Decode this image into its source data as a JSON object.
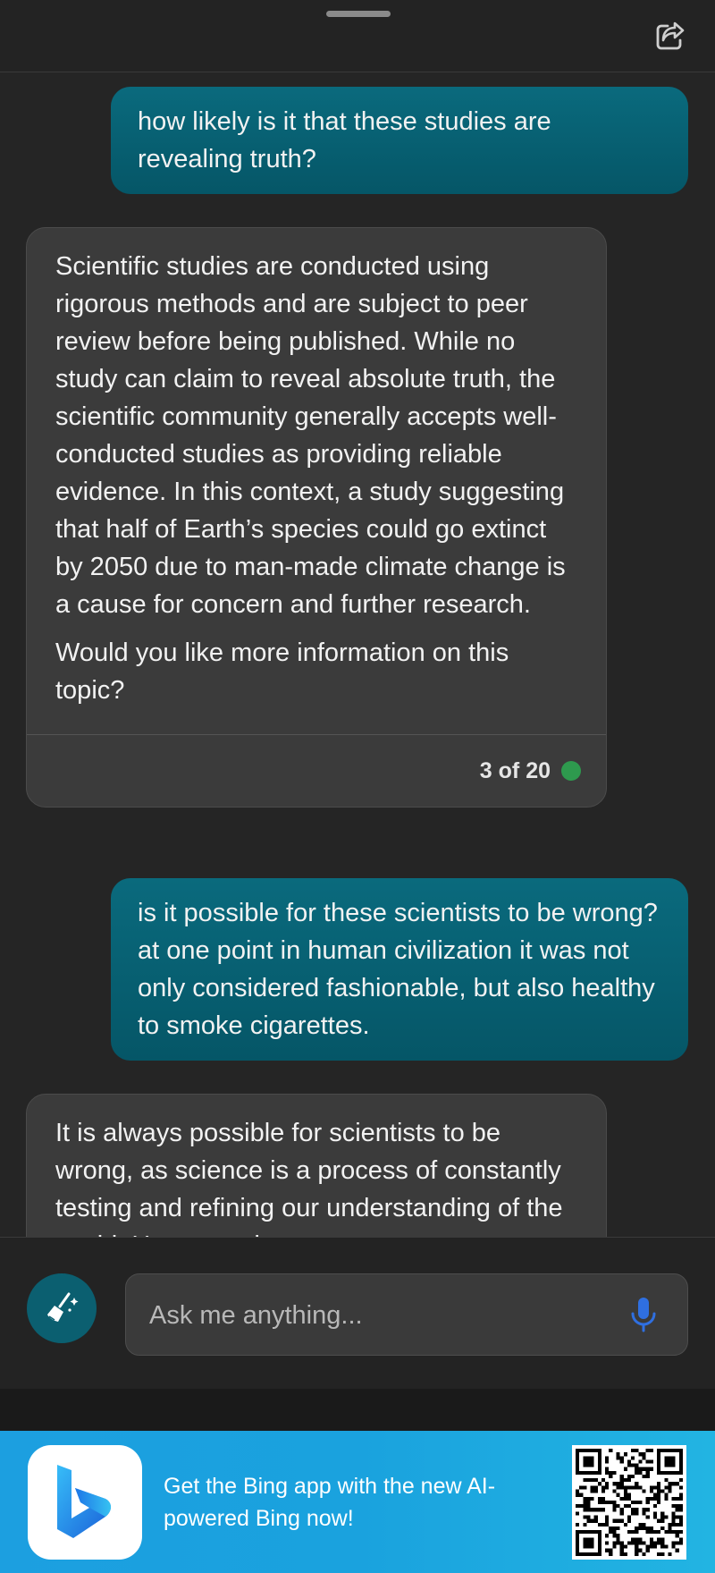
{
  "header": {
    "drag_handle": "drag-handle",
    "share_icon": "share-icon"
  },
  "messages": [
    {
      "role": "user",
      "text": "how likely is it that these studies are revealing truth?"
    },
    {
      "role": "bot",
      "paragraphs": [
        "Scientific studies are conducted using rigorous methods and are subject to peer review before being published. While no study can claim to reveal absolute truth, the scientific community generally accepts well-conducted studies as providing reliable evidence. In this context, a study suggesting that half of Earth’s species could go extinct by 2050 due to man-made climate change is a cause for concern and further research.",
        "Would you like more information on this topic?"
      ],
      "counter": "3 of 20",
      "status_color": "#2e9a4e"
    },
    {
      "role": "user",
      "text": "is it possible for these scientists to be wrong? at one point in human civilization it was not only considered fashionable, but also healthy to smoke cigarettes."
    },
    {
      "role": "bot",
      "paragraphs": [
        "It is always possible for scientists to be wrong, as science is a process of constantly testing and refining our understanding of the world. However, the"
      ]
    }
  ],
  "input": {
    "placeholder": "Ask me anything...",
    "value": "",
    "new_topic_icon": "broom-icon",
    "mic_icon": "microphone-icon"
  },
  "banner": {
    "text": "Get the Bing app with the new AI-powered Bing now!",
    "app_icon": "bing-logo-icon",
    "qr": "qr-code"
  },
  "colors": {
    "background": "#252525",
    "user_bubble": "#0a6a7d",
    "bot_bubble": "#3b3b3b",
    "accent_mic": "#2f6fe0",
    "banner": "#1c9fe0"
  }
}
